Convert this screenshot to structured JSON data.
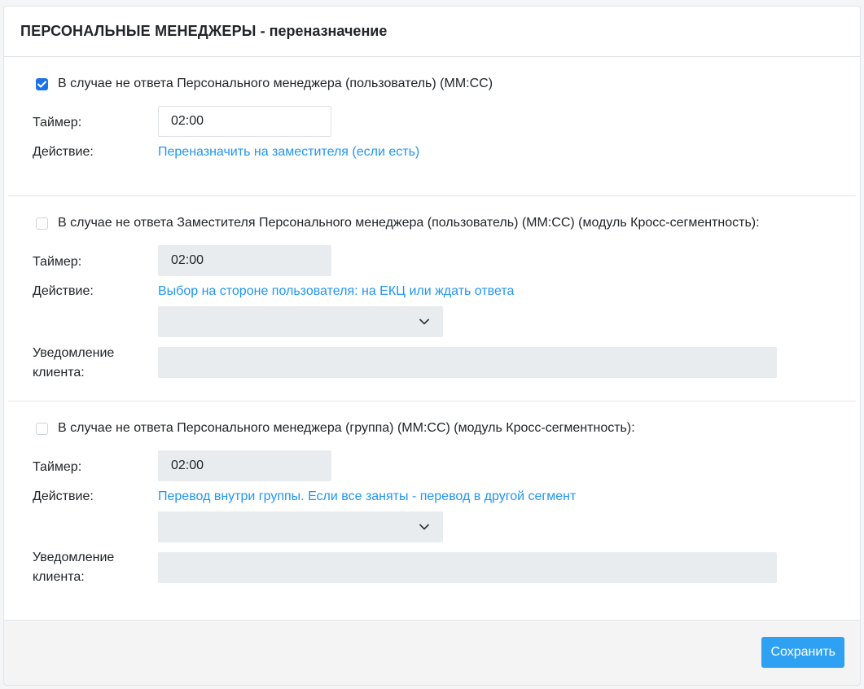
{
  "header": {
    "title_caps": "ПЕРСОНАЛЬНЫЕ МЕНЕДЖЕРЫ",
    "title_rest": " - переназначение"
  },
  "sections": [
    {
      "checked": true,
      "check_label": "В случае не ответа Персонального менеджера (пользователь) (ММ:СС)",
      "timer_label": "Таймер:",
      "timer_value": "02:00",
      "action_label": "Действие:",
      "action_link": "Переназначить на заместителя (если есть)"
    },
    {
      "checked": false,
      "check_label": "В случае не ответа Заместителя Персонального менеджера (пользователь) (ММ:СС) (модуль Кросс-сегментность):",
      "timer_label": "Таймер:",
      "timer_value": "02:00",
      "action_label": "Действие:",
      "action_link": "Выбор на стороне пользователя: на ЕКЦ или ждать ответа",
      "select_value": "",
      "notify_label_1": "Уведомление",
      "notify_label_2": "клиента:",
      "notify_value": ""
    },
    {
      "checked": false,
      "check_label": "В случае не ответа Персонального менеджера (группа) (ММ:СС) (модуль Кросс-сегментность):",
      "timer_label": "Таймер:",
      "timer_value": "02:00",
      "action_label": "Действие:",
      "action_link": "Перевод внутри группы. Если все заняты - перевод в другой сегмент",
      "select_value": "",
      "notify_label_1": "Уведомление",
      "notify_label_2": "клиента:",
      "notify_value": ""
    }
  ],
  "footer": {
    "save_label": "Сохранить"
  },
  "colors": {
    "accent": "#2fa1f2",
    "link": "#2196f3",
    "checkbox_checked": "#1a73e8",
    "disabled_field": "#e9ecef"
  },
  "icons": {
    "check": "check-icon",
    "dropdown": "chevron-down-icon"
  }
}
